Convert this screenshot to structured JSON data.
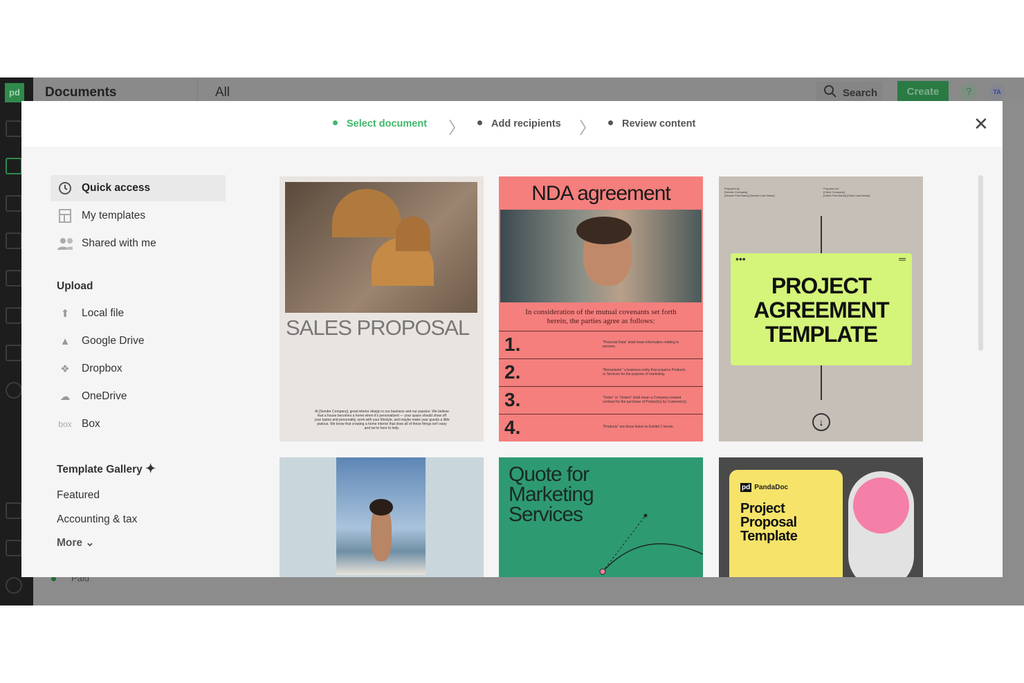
{
  "app": {
    "logo": "pd",
    "title": "Documents",
    "filter": "All",
    "search_label": "Search",
    "create_label": "Create",
    "help_label": "?",
    "avatar_initials": "TA",
    "behind_status": "Paid",
    "brand_green": "#3fb86a"
  },
  "wizard": {
    "steps": [
      {
        "label": "Select document",
        "active": true
      },
      {
        "label": "Add recipients",
        "active": false
      },
      {
        "label": "Review content",
        "active": false
      }
    ]
  },
  "sidebar": {
    "items": [
      {
        "label": "Quick access",
        "icon": "clock-icon"
      },
      {
        "label": "My templates",
        "icon": "template-icon"
      },
      {
        "label": "Shared with me",
        "icon": "people-icon"
      }
    ],
    "upload_heading": "Upload",
    "upload_items": [
      {
        "label": "Local file",
        "icon": "upload-icon"
      },
      {
        "label": "Google Drive",
        "icon": "google-drive-icon"
      },
      {
        "label": "Dropbox",
        "icon": "dropbox-icon"
      },
      {
        "label": "OneDrive",
        "icon": "onedrive-icon"
      },
      {
        "label": "Box",
        "icon": "box-icon",
        "logo": "box"
      }
    ],
    "gallery_heading": "Template Gallery",
    "gallery_items": [
      "Featured",
      "Accounting & tax"
    ],
    "more_label": "More"
  },
  "templates": [
    {
      "title": "SALES PROPOSAL",
      "body": "At [Sender Company], great interior design is our business and our passion. We believe that a house becomes a home when it's personalized — your space should show off your tastes and personality, work with your lifestyle, and maybe make your guests a little jealous. We know that creating a home interior that does all of these things isn't easy and we're here to help."
    },
    {
      "title": "NDA agreement",
      "intro": "In consideration of the mutual covenants set forth herein, the parties agree as follows:",
      "clauses": [
        {
          "n": "1.",
          "text": "\"Personal Data\" shall mean information relating to persons."
        },
        {
          "n": "2.",
          "text": "\"Remarketer\" a business entity that acquires Products or Services for the purpose of marketing."
        },
        {
          "n": "3.",
          "text": "\"Order\" or \"Orders\" shall mean a Company-created contract for the purchase of Product(s) by Customer(s)."
        },
        {
          "n": "4.",
          "text": "\"Products\" are those listed on Exhibit 1 hereto."
        }
      ]
    },
    {
      "title": "PROJECT AGREEMENT TEMPLATE",
      "prepared_by_label": "Prepared by",
      "sender": "[Sender Company]",
      "sender_name": "[Sender First Name] [Sender Last Name]",
      "prepared_for_label": "Prepared for",
      "client": "[Client Company]",
      "client_name": "[Client First Name] [Client Last Name]"
    },
    {
      "title": ""
    },
    {
      "title": "Quote for Marketing Services"
    },
    {
      "brand": "PandaDoc",
      "brand_logo": "pd",
      "title": "Project Proposal Template"
    }
  ]
}
